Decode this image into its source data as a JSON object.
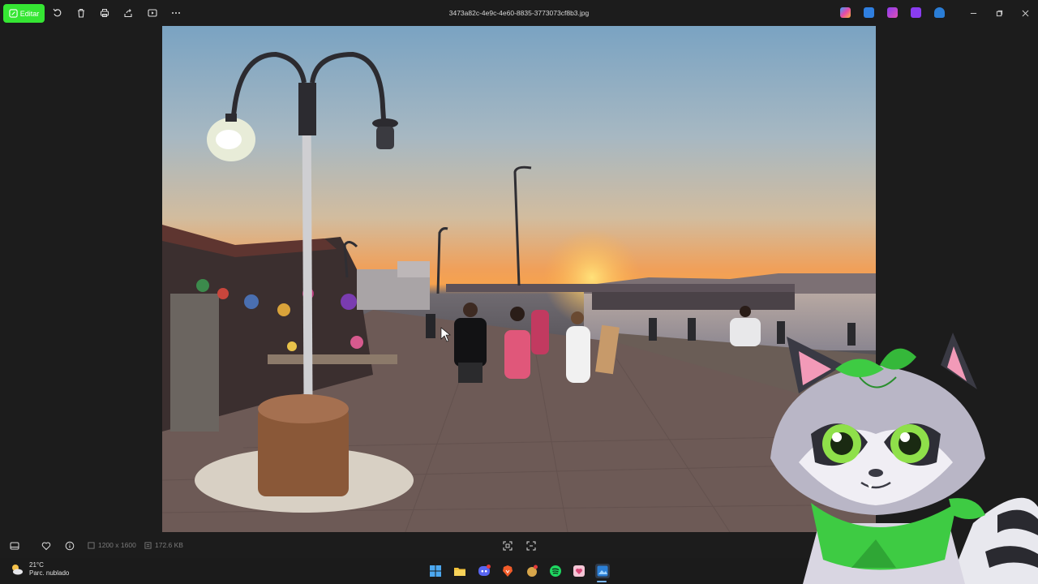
{
  "titlebar": {
    "edit_label": "Editar",
    "filename": "3473a82c-4e9c-4e60-8835-3773073cf8b3.jpg",
    "toolbar_icons": [
      "rotate-icon",
      "delete-icon",
      "print-icon",
      "share-icon",
      "slideshow-icon",
      "more-icon"
    ],
    "app_icons": [
      "copilot-icon",
      "photos-edit-icon",
      "clipchamp-icon",
      "designer-icon",
      "onedrive-icon"
    ]
  },
  "bottombar": {
    "dimensions": "1200 x 1600",
    "file_size": "172.6 KB"
  },
  "taskbar": {
    "temperature": "21°C",
    "condition": "Parc. nublado",
    "apps": [
      "windows-start",
      "file-explorer",
      "discord",
      "brave",
      "taskbar-app",
      "spotify",
      "app-pink",
      "photos"
    ],
    "discord_badge": "1"
  },
  "colors": {
    "edit_button": "#35e633",
    "background": "#1c1c1c",
    "accent": "#7ab7ff"
  }
}
